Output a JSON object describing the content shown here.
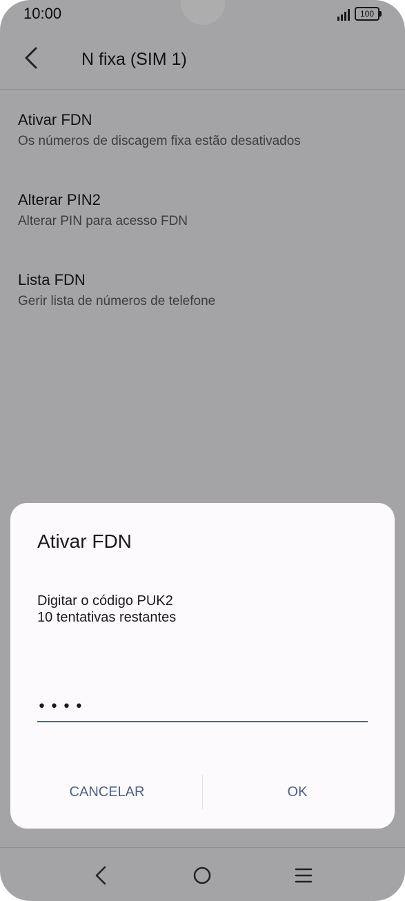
{
  "status_bar": {
    "time": "10:00",
    "battery": "100",
    "icons": [
      "signal-icon",
      "battery-icon"
    ]
  },
  "app_bar": {
    "title": "N fixa (SIM 1)",
    "back_icon": "chevron-left-icon"
  },
  "settings": {
    "items": [
      {
        "title": "Ativar FDN",
        "subtitle": "Os números de discagem fixa estão desativados"
      },
      {
        "title": "Alterar PIN2",
        "subtitle": "Alterar PIN para acesso FDN"
      },
      {
        "title": "Lista FDN",
        "subtitle": "Gerir lista de números de telefone"
      }
    ]
  },
  "dialog": {
    "title": "Ativar FDN",
    "message_line1": "Digitar o código PUK2",
    "message_line2": "10 tentativas restantes",
    "input_value": "••••",
    "cancel_label": "CANCELAR",
    "ok_label": "OK"
  },
  "nav_bar": {
    "icons": [
      "nav-back-icon",
      "home-circle-icon",
      "menu-lines-icon"
    ]
  },
  "colors": {
    "accent": "#47628c",
    "dialog_bg": "#fcfafd",
    "screen_bg": "#f2f2f5"
  }
}
